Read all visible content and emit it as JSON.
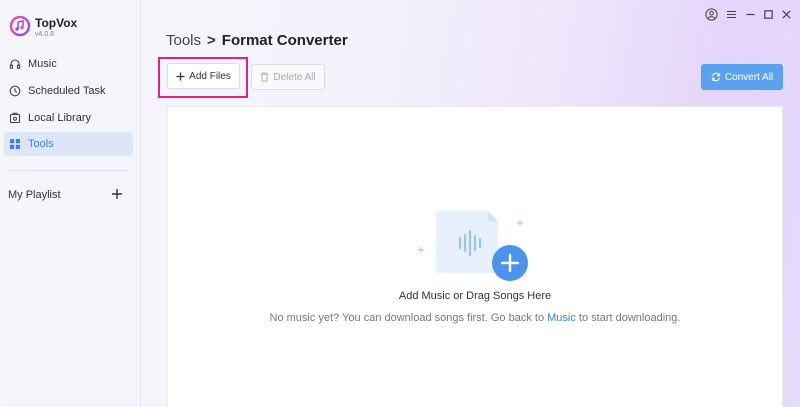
{
  "app": {
    "name": "TopVox",
    "version": "v4.0.8"
  },
  "sidebar": {
    "items": [
      {
        "label": "Music",
        "icon": "headphones-icon"
      },
      {
        "label": "Scheduled Task",
        "icon": "clock-icon"
      },
      {
        "label": "Local Library",
        "icon": "library-icon"
      },
      {
        "label": "Tools",
        "icon": "grid-icon",
        "active": true
      }
    ],
    "playlist_label": "My Playlist"
  },
  "breadcrumb": {
    "root": "Tools",
    "separator": ">",
    "current": "Format Converter"
  },
  "toolbar": {
    "add_files_label": "Add Files",
    "delete_all_label": "Delete All",
    "convert_all_label": "Convert All"
  },
  "dropzone": {
    "title": "Add Music or Drag Songs Here",
    "hint_before": "No music yet? You can download songs first. Go back to ",
    "hint_link": "Music",
    "hint_after": " to start downloading."
  },
  "colors": {
    "accent": "#3b7fe6",
    "convert_button": "#5aa2ef",
    "highlight": "#e51f87",
    "active_nav_bg": "#dde6f6"
  }
}
